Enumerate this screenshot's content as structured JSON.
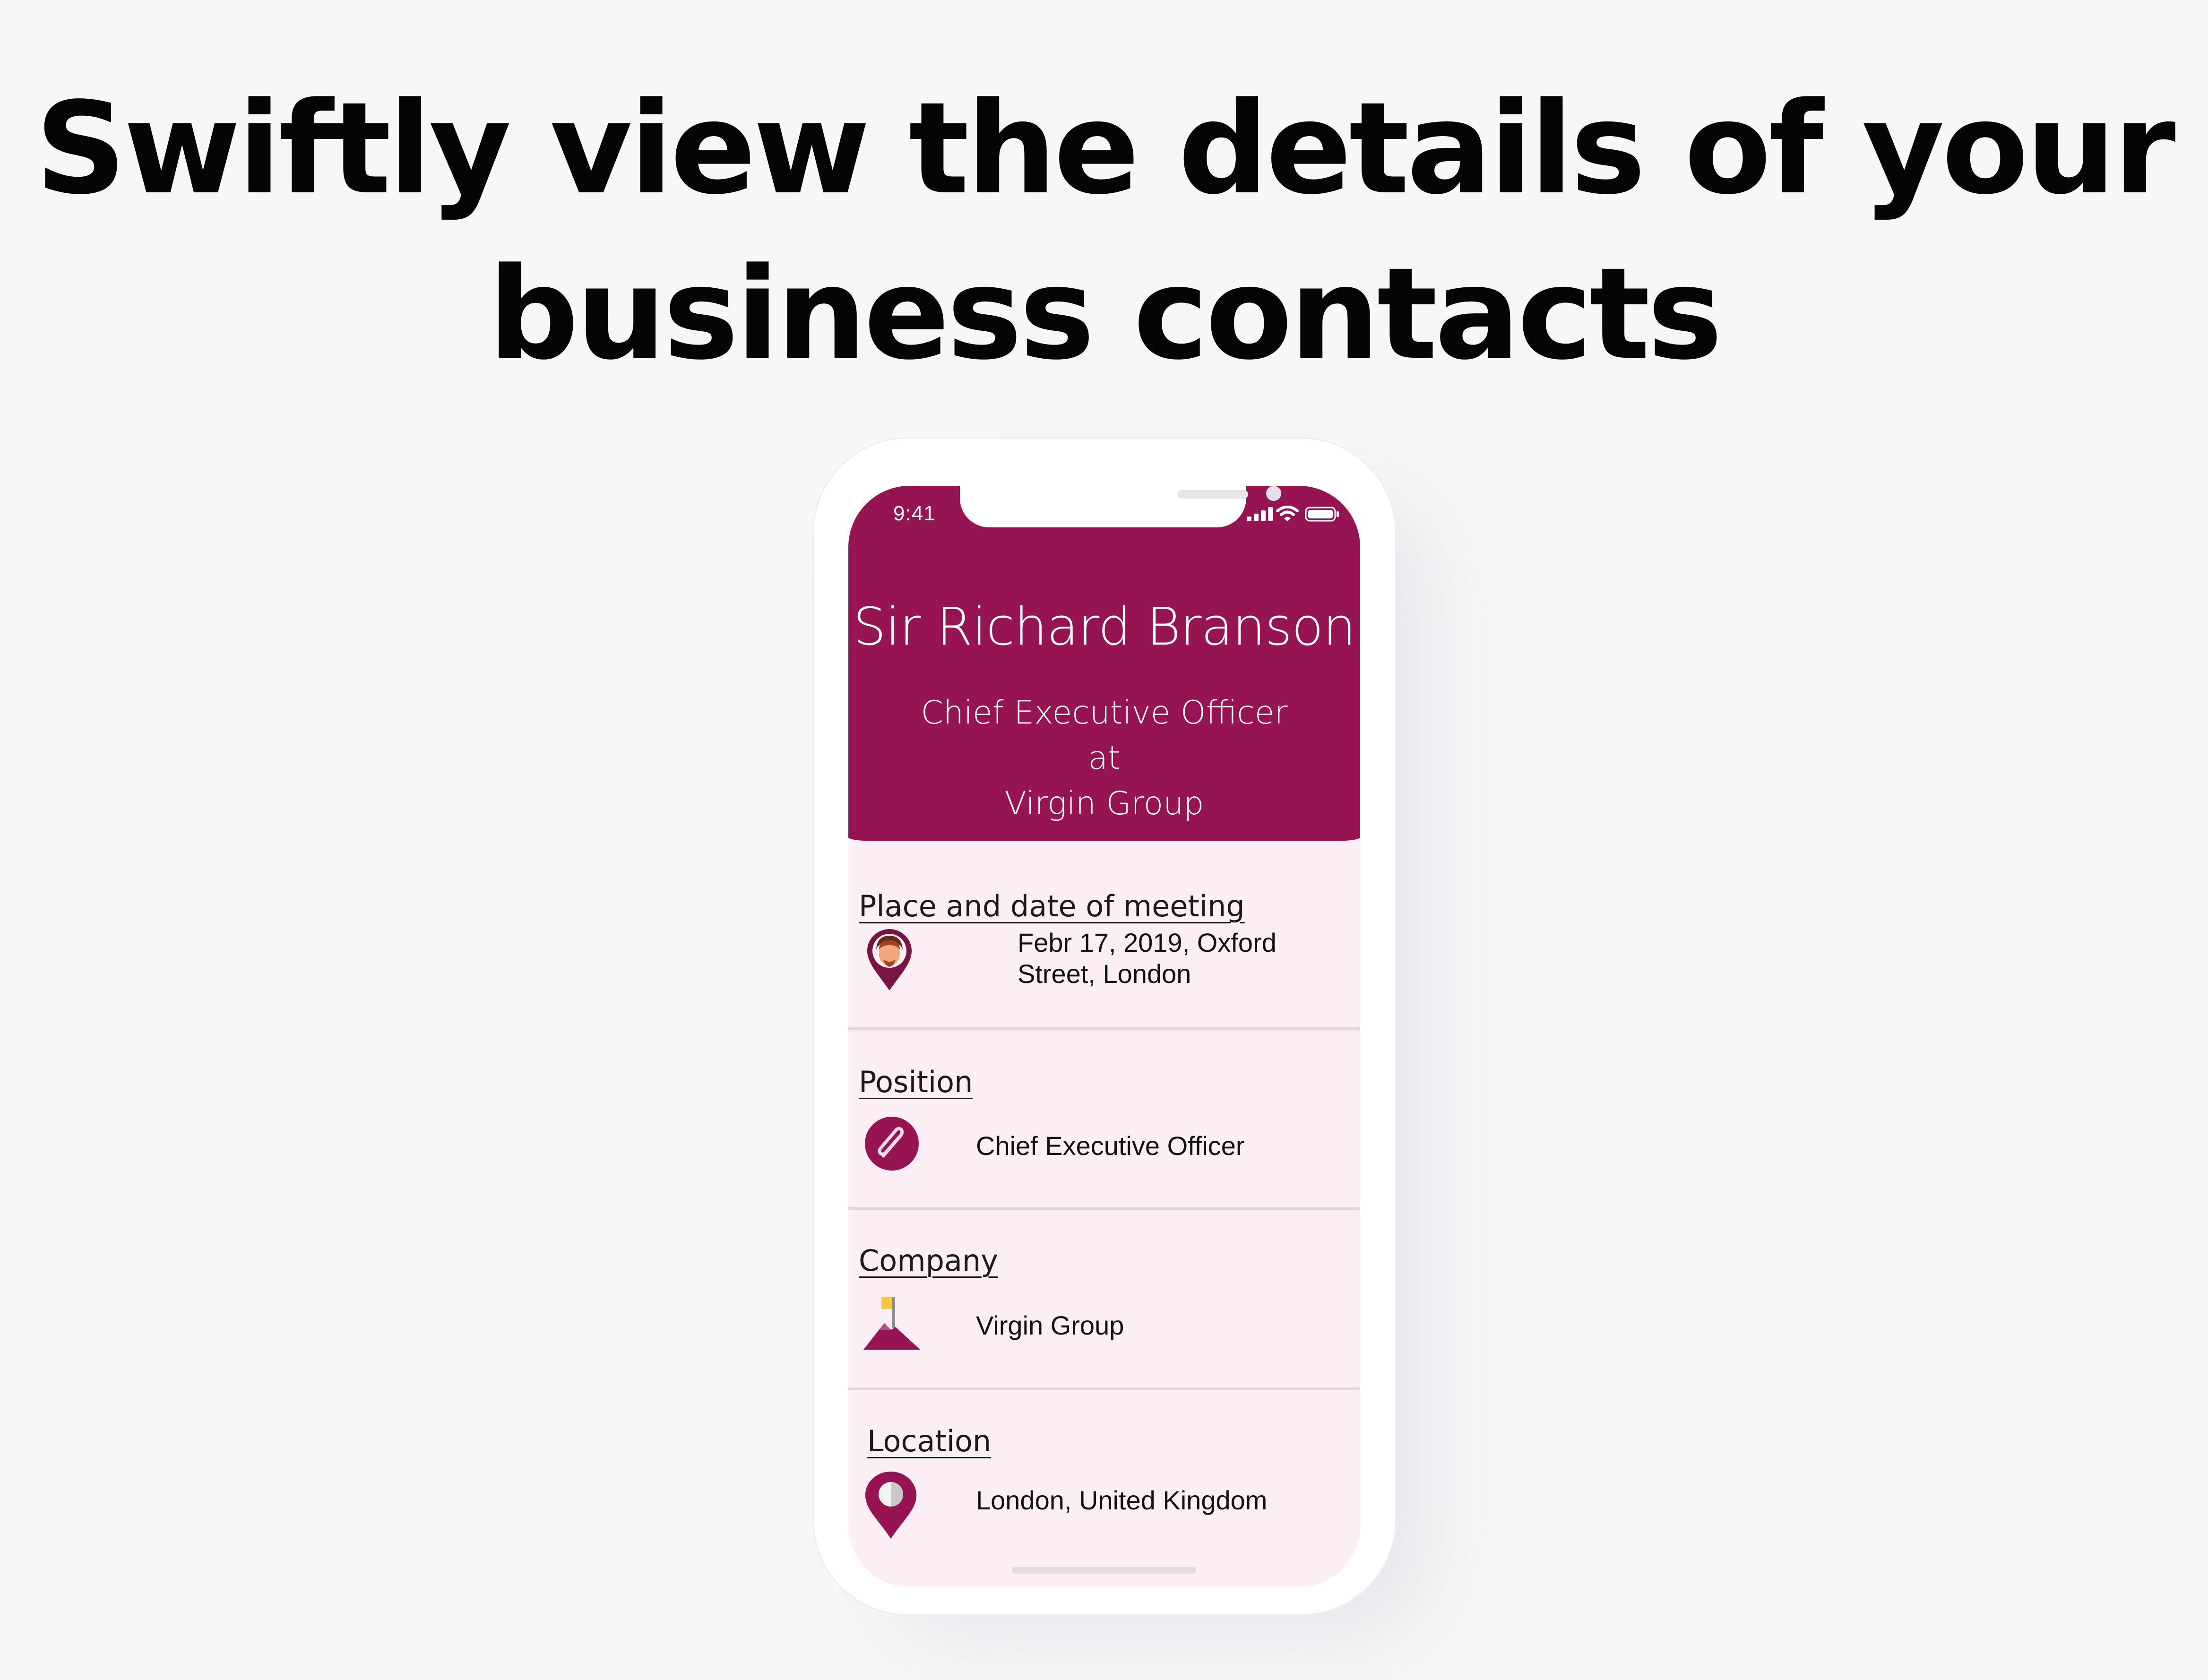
{
  "headline": {
    "line1": "Swiftly view the details of your",
    "line2": "business contacts"
  },
  "status_bar": {
    "time": "9:41",
    "icons": [
      "signal-icon",
      "wifi-icon",
      "battery-icon"
    ]
  },
  "contact": {
    "name": "Sir Richard Branson",
    "role_line1": "Chief Executive Officer at",
    "role_line2": "Virgin Group"
  },
  "sections": [
    {
      "label": "Place and date of meeting",
      "value_line1": "Febr 17, 2019, Oxford",
      "value_line2": "Street, London",
      "icon": "meeting-pin-icon"
    },
    {
      "label": "Position",
      "value": "Chief Executive Officer",
      "icon": "paperclip-icon"
    },
    {
      "label": "Company",
      "value": "Virgin Group",
      "icon": "mountain-flag-icon"
    },
    {
      "label": "Location",
      "value": "London, United Kingdom",
      "icon": "location-pin-icon"
    }
  ],
  "colors": {
    "accent": "#951451",
    "screen_bg": "#fbeef4",
    "page_bg": "#f6f7f9",
    "divider": "#e6d6de",
    "flag": "#f4c542"
  }
}
